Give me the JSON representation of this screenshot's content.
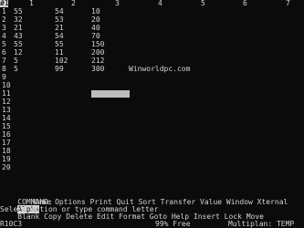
{
  "sheet": {
    "corner_label": "#1",
    "columns": [
      "1",
      "2",
      "3",
      "4",
      "5",
      "6",
      "7"
    ],
    "rows": [
      "1",
      "2",
      "3",
      "4",
      "5",
      "6",
      "7",
      "8",
      "9",
      "10",
      "11",
      "12",
      "13",
      "14",
      "15",
      "16",
      "17",
      "18",
      "19",
      "20"
    ],
    "cells": {
      "r1": [
        "55",
        "54",
        "10"
      ],
      "r2": [
        "32",
        "53",
        "20"
      ],
      "r3": [
        "21",
        "21",
        "40"
      ],
      "r4": [
        "43",
        "54",
        "70"
      ],
      "r5": [
        "55",
        "55",
        "150"
      ],
      "r6": [
        "12",
        "11",
        "200"
      ],
      "r7": [
        "5",
        "102",
        "212"
      ],
      "r8": [
        "5",
        "99",
        "300"
      ]
    },
    "watermark": "Winworldpc.com"
  },
  "command": {
    "prompt": "COMMAND:",
    "selected": "Alpha",
    "line1_rest": "Blank Copy Delete Edit Format Goto Help Insert Lock Move",
    "line2": "Name Options Print Quit Sort Transfer Value Window Xternal",
    "message": "Select option or type command letter"
  },
  "status": {
    "cell": "R10C3",
    "free": "99% Free",
    "file": "Multiplan: TEMP"
  }
}
